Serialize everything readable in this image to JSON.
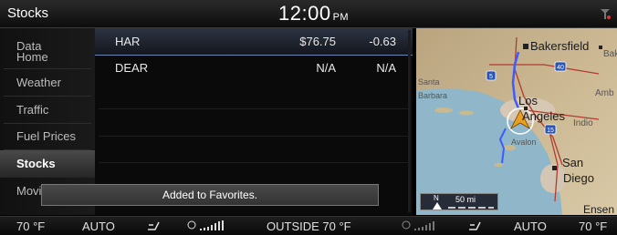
{
  "header": {
    "title": "Stocks",
    "time": "12:00",
    "ampm": "PM"
  },
  "sidebar": {
    "items": [
      {
        "label": "Data\nHome"
      },
      {
        "label": "Weather"
      },
      {
        "label": "Traffic"
      },
      {
        "label": "Fuel Prices"
      },
      {
        "label": "Stocks"
      },
      {
        "label": "Movi"
      }
    ],
    "active_index": 4
  },
  "stocks": {
    "rows": [
      {
        "symbol": "HAR",
        "price": "$76.75",
        "change": "-0.63"
      },
      {
        "symbol": "DEAR",
        "price": "N/A",
        "change": "N/A"
      }
    ]
  },
  "toast": {
    "message": "Added to Favorites."
  },
  "map": {
    "labels": [
      "Bakersfield",
      "Bak",
      "Santa",
      "Barbara",
      "Los",
      "Angeles",
      "Amb",
      "Indio",
      "Avalon",
      "San",
      "Diego",
      "Ensen"
    ],
    "shields": [
      "5",
      "40",
      "15"
    ],
    "scale": {
      "north": "N",
      "distance": "50 mi"
    }
  },
  "climate": {
    "left_temp": "70 °F",
    "left_mode": "AUTO",
    "outside": "OUTSIDE  70 °F",
    "right_mode": "AUTO",
    "right_temp": "70 °F"
  },
  "colors": {
    "accent": "#6a88b8",
    "route": "#3b5cff"
  }
}
